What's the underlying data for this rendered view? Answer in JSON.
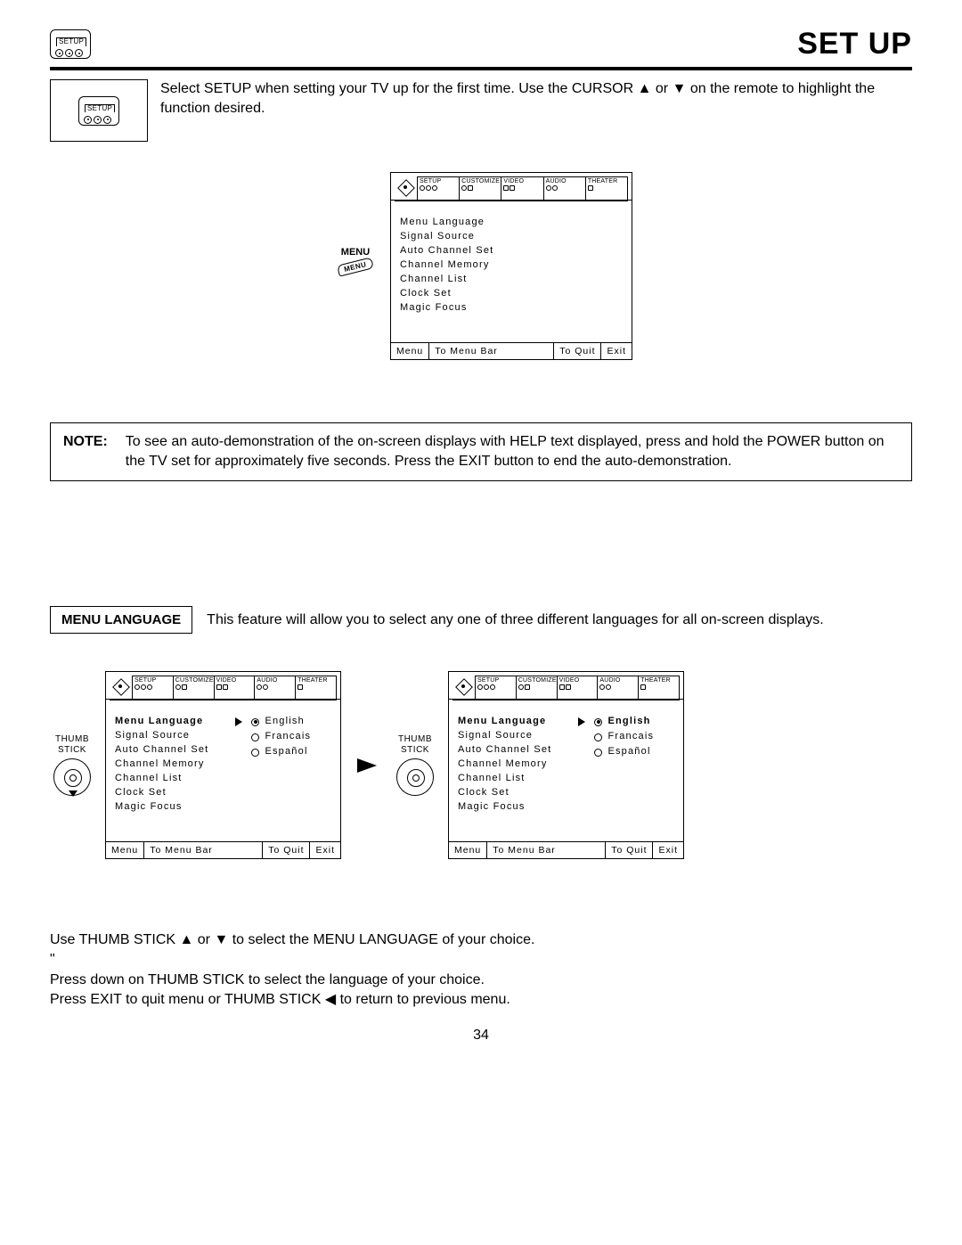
{
  "header": {
    "badge_label": "SETUP",
    "title": "SET UP"
  },
  "intro": {
    "badge_label": "SETUP",
    "text": "Select SETUP when setting your TV up for the first time.  Use the CURSOR ▲ or ▼ on the remote to highlight the function desired."
  },
  "menu_side_label": "MENU",
  "menu_bubble": "MENU",
  "osd_tabs": {
    "t1": "SETUP",
    "t2": "CUSTOMIZE",
    "t3": "VIDEO",
    "t4": "AUDIO",
    "t5": "THEATER"
  },
  "osd_items": {
    "i1": "Menu Language",
    "i2": "Signal Source",
    "i3": "Auto Channel Set",
    "i4": "Channel Memory",
    "i5": "Channel List",
    "i6": "Clock Set",
    "i7": "Magic Focus"
  },
  "osd_footer": {
    "f1": "Menu",
    "f2": "To Menu Bar",
    "f3": "To Quit",
    "f4": "Exit"
  },
  "note": {
    "label": "NOTE:",
    "text": "To see an auto-demonstration of the on-screen displays with HELP text displayed, press and hold the POWER button on the TV set for approximately five seconds. Press the EXIT button to end the auto-demonstration."
  },
  "section": {
    "heading": "MENU LANGUAGE",
    "desc": "This feature will allow you to select any one of three different languages for all on-screen displays."
  },
  "thumb_label": {
    "l1": "THUMB",
    "l2": "STICK"
  },
  "lang_opts": {
    "o1": "English",
    "o2": "Francais",
    "o3": "Español"
  },
  "instructions": {
    "l1": "Use THUMB STICK ▲ or ▼ to select the MENU LANGUAGE of your choice.",
    "l2": "Press down on THUMB STICK to select the language of your choice.",
    "l3": "Press EXIT to quit menu or THUMB STICK ◀ to return to previous menu."
  },
  "page_number": "34"
}
